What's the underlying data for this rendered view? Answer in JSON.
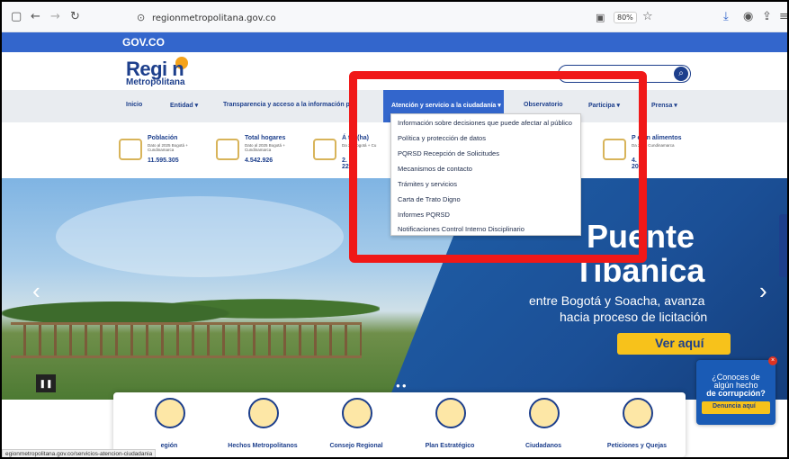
{
  "browser": {
    "url": "regionmetropolitana.gov.co",
    "zoom": "80%",
    "status_url": "egionmetropolitana.gov.co/servicios-atencion-ciudadania"
  },
  "govbar": {
    "label": "GOV.CO"
  },
  "header": {
    "logo_top": "Regi   n",
    "logo_bottom": "Metropolitana"
  },
  "nav": {
    "items": [
      "Inicio",
      "Entidad ▾",
      "Transparencia y acceso a la información pú",
      "Observatorio",
      "Participa ▾",
      "Prensa ▾"
    ],
    "active": "Atención y servicio a la ciudadanía ▾"
  },
  "dropdown": {
    "items": [
      "Información sobre decisiones que puede afectar al público",
      "Política y protección de datos",
      "PQRSD Recepción de Solicitudes",
      "Mecanismos de contacto",
      "Trámites y servicios",
      "Carta de Trato Digno",
      "Informes PQRSD",
      "Notificaciones Control Interno Disciplinario"
    ]
  },
  "stats": [
    {
      "title": "Población",
      "sub": "Dato al 2025 Bogotá + Cundinamarca",
      "value": "11.595.305"
    },
    {
      "title": "Total hogares",
      "sub": "Dato al 2025 Bogotá + Cundinamarca",
      "value": "4.542.926"
    },
    {
      "title": "Á        tal (ha)",
      "sub": "Da        25 Bogotá + Cu",
      "value": "2.        22"
    },
    {
      "title": "P        ción alimentos",
      "sub": "Da        2025 Cundinamarca",
      "value": "4.        200"
    }
  ],
  "hero": {
    "title1": "Puente",
    "title2": "Tibanica",
    "sub1": "entre Bogotá y Soacha, avanza",
    "sub2": "hacia proceso de licitación",
    "cta": "Ver aquí"
  },
  "cards": [
    {
      "label": "egión"
    },
    {
      "label": "Hechos Metropolitanos"
    },
    {
      "label": "Consejo Regional"
    },
    {
      "label": "Plan Estratégico"
    },
    {
      "label": "Ciudadanos"
    },
    {
      "label": "Peticiones y Quejas"
    }
  ],
  "corruption": {
    "line1": "¿Conoces de",
    "line2": "algún hecho",
    "line3": "de corrupción?",
    "button": "Denuncia aquí"
  },
  "colors": {
    "brand": "#1d3f8c",
    "govbar": "#3366cc",
    "accent": "#f7c21b",
    "annotation": "#f01818"
  }
}
